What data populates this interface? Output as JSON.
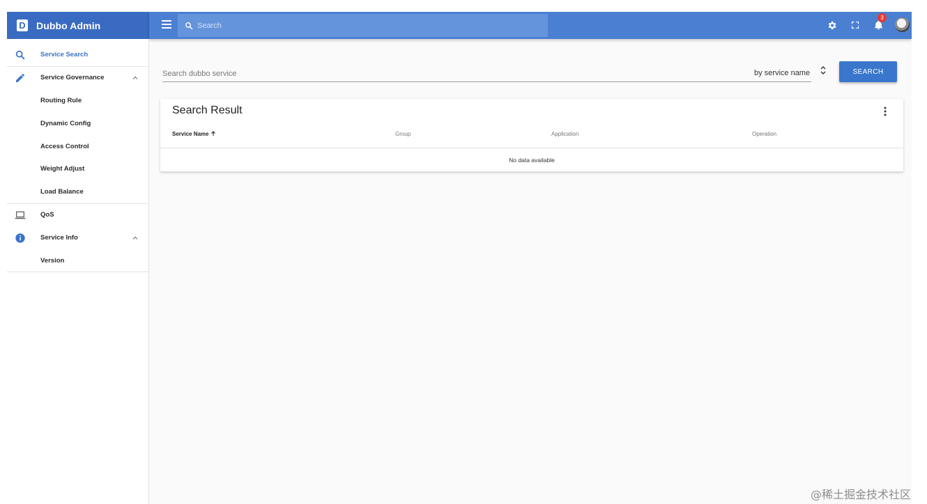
{
  "app": {
    "title": "Dubbo Admin",
    "logo_letter": "D"
  },
  "toolbar": {
    "search_placeholder": "Search",
    "notification_count": "3"
  },
  "sidebar": {
    "items": [
      {
        "label": "Service Search",
        "icon": "search-icon"
      },
      {
        "label": "Service Governance",
        "icon": "pencil-icon"
      },
      {
        "label": "Routing Rule"
      },
      {
        "label": "Dynamic Config"
      },
      {
        "label": "Access Control"
      },
      {
        "label": "Weight Adjust"
      },
      {
        "label": "Load Balance"
      },
      {
        "label": "QoS",
        "icon": "laptop-icon"
      },
      {
        "label": "Service Info",
        "icon": "info-icon"
      },
      {
        "label": "Version"
      }
    ]
  },
  "main": {
    "search_placeholder": "Search dubbo service",
    "search_by": "by service name",
    "search_button": "SEARCH",
    "result": {
      "title": "Search Result",
      "columns": [
        "Service Name",
        "Group",
        "Application",
        "Operation"
      ],
      "empty_text": "No data available"
    }
  },
  "watermark": "@稀土掘金技术社区",
  "colors": {
    "header": "#4a7fd2",
    "logo_bar": "#3a6bc2",
    "accent": "#3a77cc",
    "badge": "#e53935"
  }
}
